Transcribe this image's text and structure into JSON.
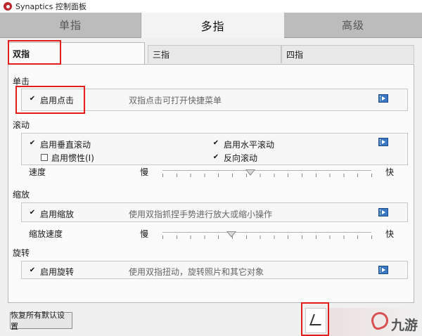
{
  "window": {
    "title": "Synaptics 控制面板"
  },
  "top_tabs": [
    {
      "label": "单指",
      "active": false
    },
    {
      "label": "多指",
      "active": true
    },
    {
      "label": "高级",
      "active": false
    }
  ],
  "sub_tabs": [
    {
      "label": "双指",
      "active": true
    },
    {
      "label": "三指",
      "active": false
    },
    {
      "label": "四指",
      "active": false
    }
  ],
  "sections": {
    "tap": {
      "title": "单击",
      "enable_tap": {
        "label": "启用点击",
        "checked": true,
        "description": "双指点击可打开快捷菜单"
      }
    },
    "scroll": {
      "title": "滚动",
      "vertical": {
        "label": "启用垂直滚动",
        "checked": true
      },
      "horizontal": {
        "label": "启用水平滚动",
        "checked": true
      },
      "inertia": {
        "label": "启用惯性(I)",
        "checked": false
      },
      "reverse": {
        "label": "反向滚动",
        "checked": true
      },
      "speed": {
        "label": "速度",
        "min_label": "慢",
        "max_label": "快",
        "value": 0.42
      }
    },
    "zoom": {
      "title": "缩放",
      "enable_zoom": {
        "label": "启用缩放",
        "checked": true,
        "description": "使用双指抓捏手势进行放大或缩小操作"
      },
      "speed": {
        "label": "缩放速度",
        "min_label": "慢",
        "max_label": "快",
        "value": 0.33
      }
    },
    "rotate": {
      "title": "旋转",
      "enable_rotate": {
        "label": "启用旋转",
        "checked": true,
        "description": "使用双指扭动，旋转照片和其它对象"
      }
    }
  },
  "footer": {
    "reset_label": "恢复所有默认设置"
  },
  "watermark": {
    "text": "九游"
  },
  "icons": {
    "checkmark": "✔",
    "video": "video-demo-icon"
  },
  "colors": {
    "highlight": "#e21b1b",
    "inactive_tab": "#bcbcbc",
    "video_icon": "#3a78c4"
  }
}
